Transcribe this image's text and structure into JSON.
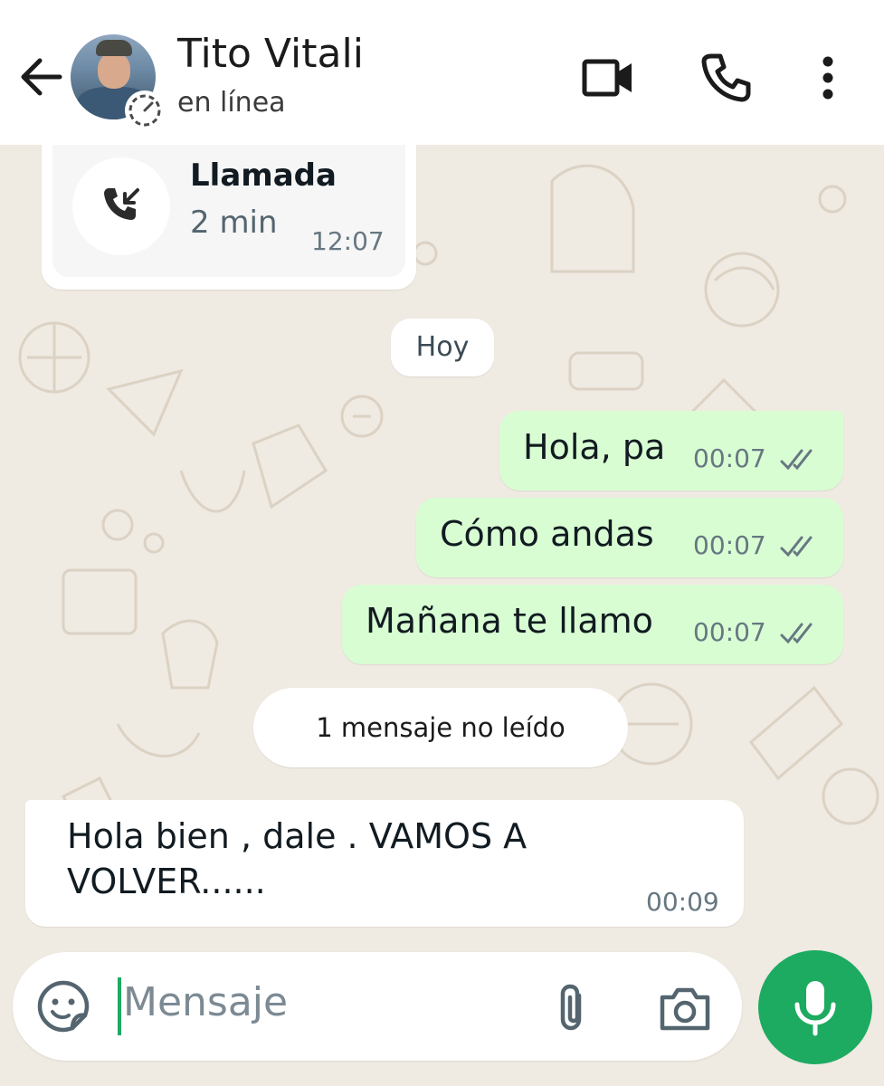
{
  "header": {
    "contact_name": "Tito Vitali",
    "status": "en línea",
    "icons": [
      "back-arrow-icon",
      "video-call-icon",
      "phone-icon",
      "more-vert-icon"
    ]
  },
  "call_message": {
    "title": "Llamada",
    "duration": "2 min",
    "time": "12:07"
  },
  "date_divider": "Hoy",
  "outgoing_messages": [
    {
      "text": "Hola, pa",
      "time": "00:07"
    },
    {
      "text": "Cómo andas",
      "time": "00:07"
    },
    {
      "text": "Mañana te llamo",
      "time": "00:07"
    }
  ],
  "unread_divider": "1 mensaje no leído",
  "incoming_message": {
    "line1": "Hola bien , dale . VAMOS A",
    "line2": "VOLVER......",
    "time": "00:09"
  },
  "composer": {
    "placeholder": "Mensaje"
  },
  "colors": {
    "outgoing_bubble": "#d9fdd3",
    "accent_green": "#1daa61",
    "wallpaper": "#efeae2"
  }
}
